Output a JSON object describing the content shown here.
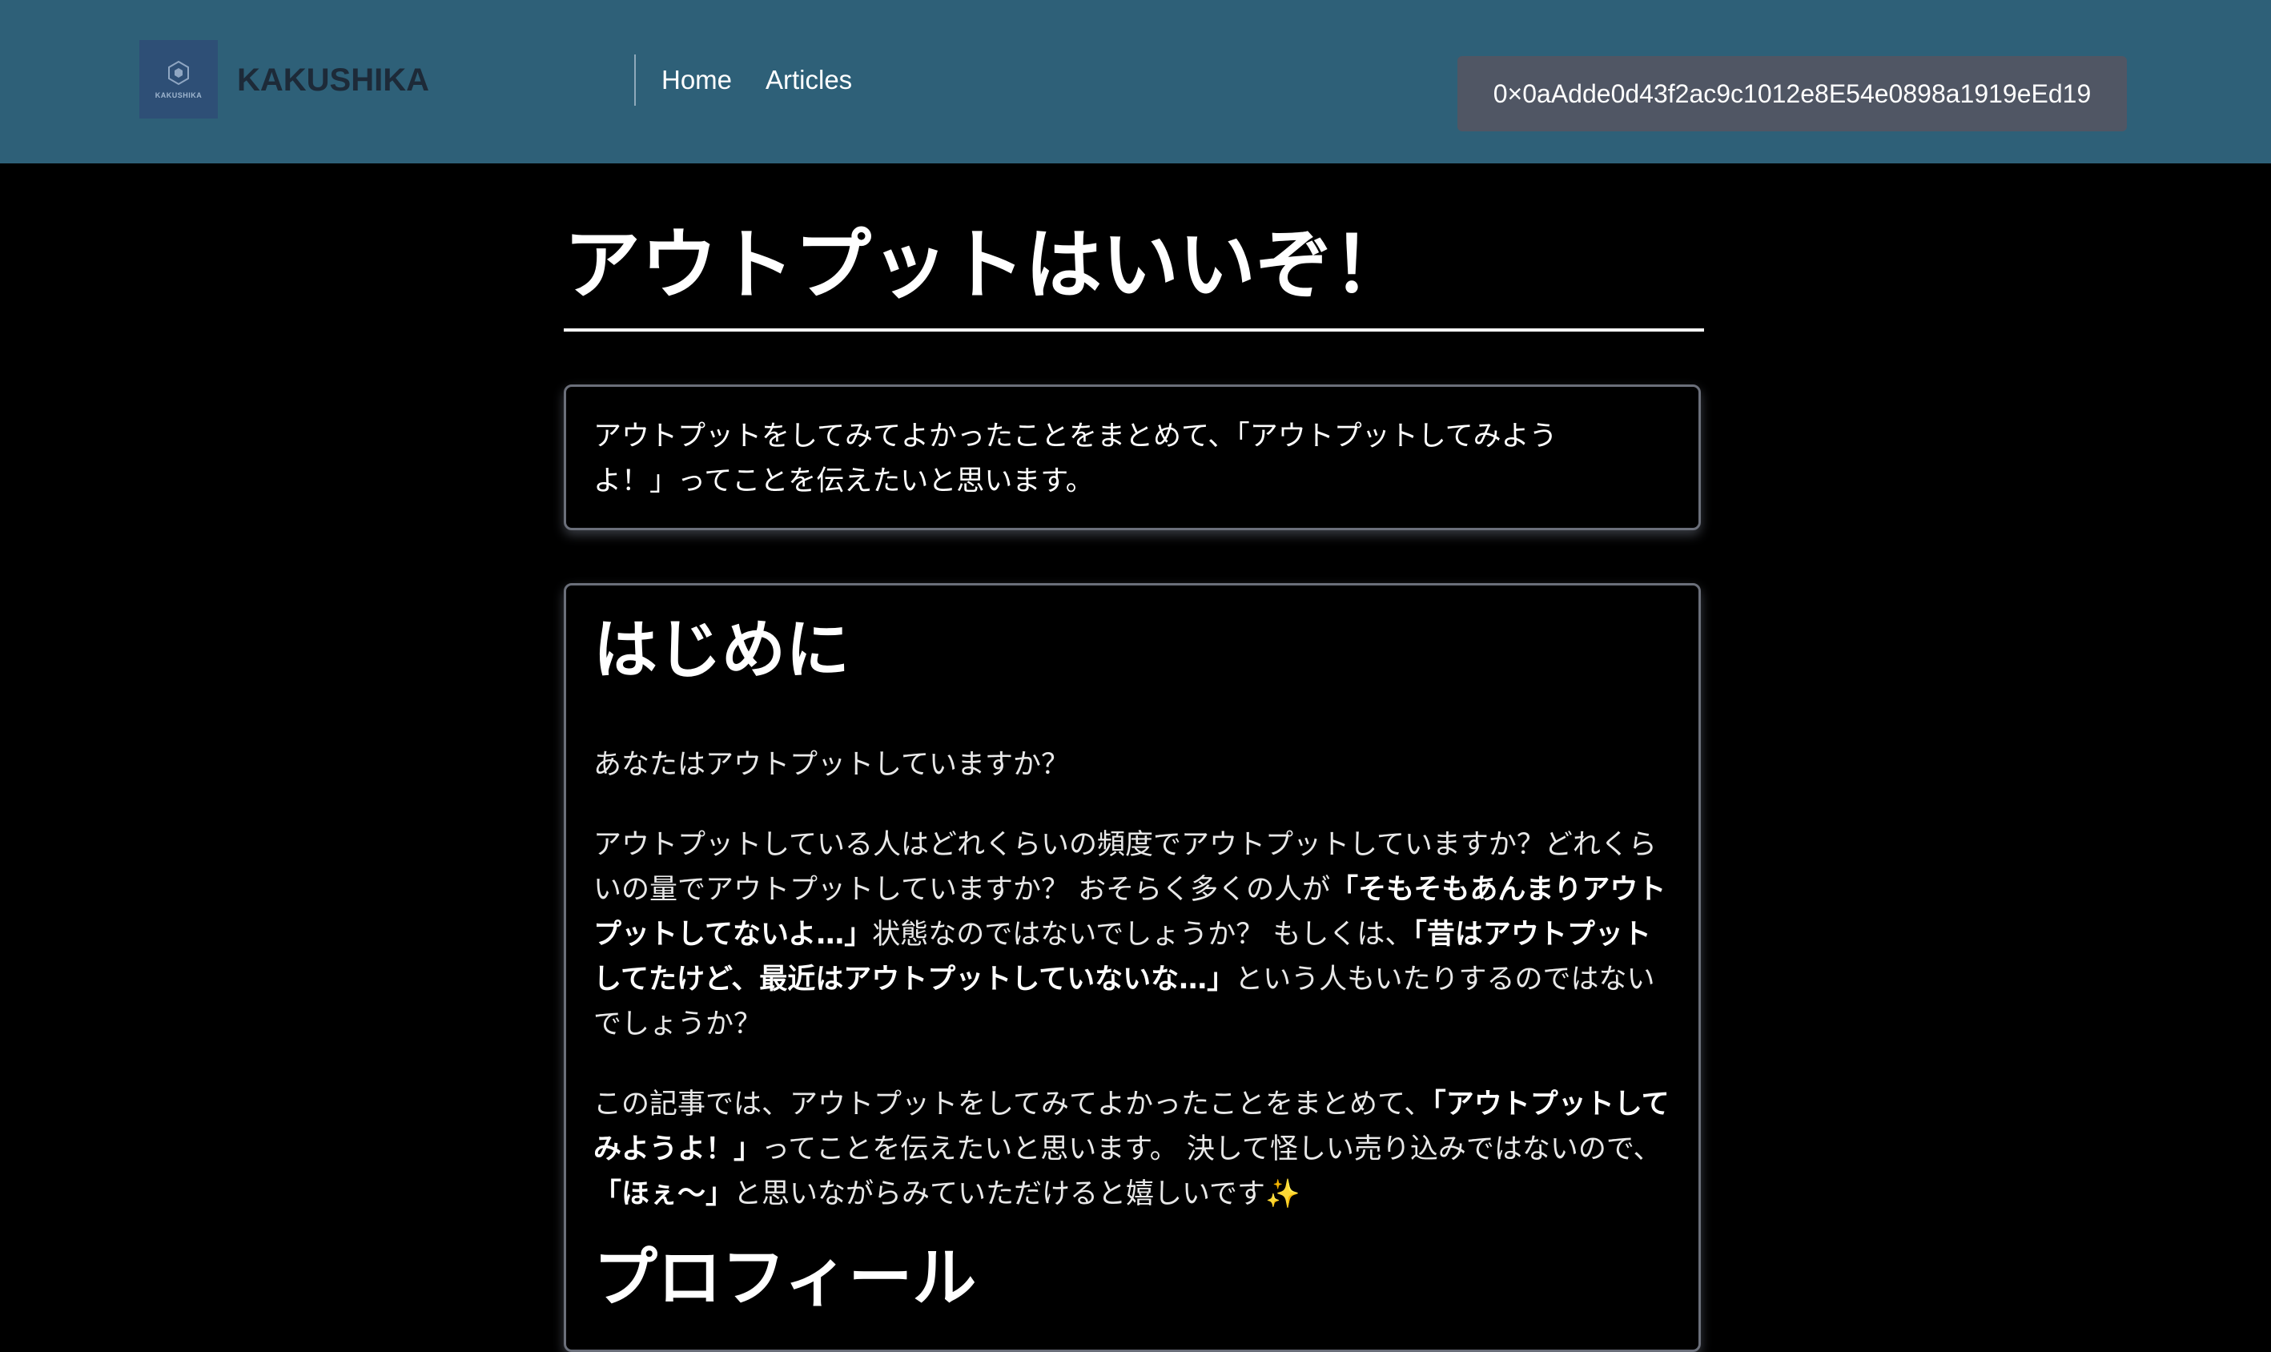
{
  "header": {
    "logo_text": "KAKUSHIKA",
    "brand_name": "KAKUSHIKA",
    "nav": [
      "Home",
      "Articles"
    ],
    "wallet_address": "0×0aAdde0d43f2ac9c1012e8E54e0898a1919eEd19"
  },
  "article": {
    "title": "アウトプットはいいぞ！",
    "summary": "アウトプットをしてみてよかったことをまとめて、「アウトプットしてみようよ！」ってことを伝えたいと思います。",
    "section1": {
      "heading": "はじめに",
      "p1": "あなたはアウトプットしていますか？",
      "p2": {
        "t1": "アウトプットしている人はどれくらいの頻度でアウトプットしていますか？どれくらいの量でアウトプットしていますか？ おそらく多くの人が",
        "b1": "「そもそもあんまりアウトプットしてないよ…」",
        "t2": "状態なのではないでしょうか？ もしくは、",
        "b2": "「昔はアウトプットしてたけど、最近はアウトプットしていないな…」",
        "t3": "という人もいたりするのではないでしょうか？"
      },
      "p3": {
        "t1": "この記事では、アウトプットをしてみてよかったことをまとめて、",
        "b1": "「アウトプットしてみようよ！」",
        "t2": "ってことを伝えたいと思います。 決して怪しい売り込みではないので、",
        "b2": "「ほぇ〜」",
        "t3": "と思いながらみていただけると嬉しいです✨"
      }
    },
    "section2": {
      "heading": "プロフィール"
    }
  }
}
